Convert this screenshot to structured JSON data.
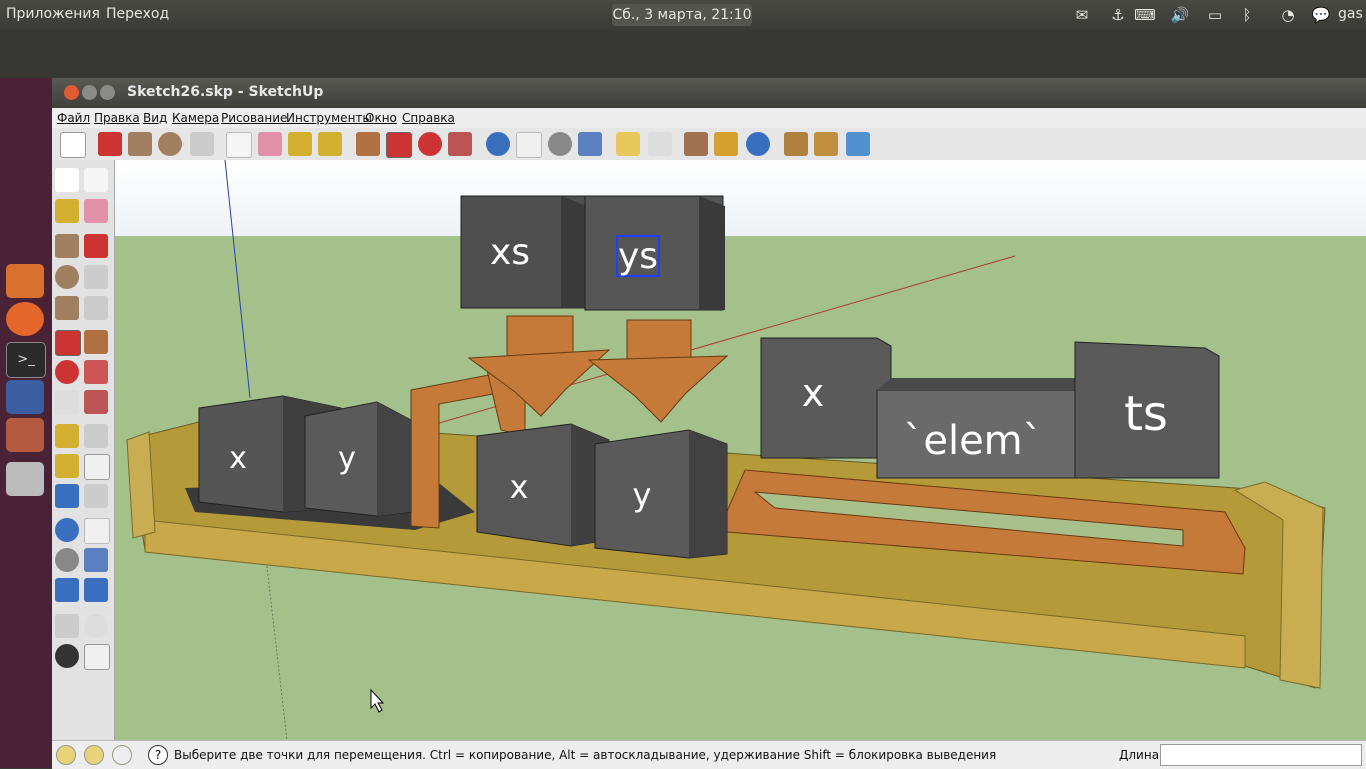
{
  "topbar": {
    "apps": "Приложения",
    "goto": "Переход",
    "clock": "Сб., 3 марта, 21:10",
    "user": "gas"
  },
  "window": {
    "title": "Sketch26.skp - SketchUp"
  },
  "menu": [
    "Файл",
    "Правка",
    "Вид",
    "Камера",
    "Рисование",
    "Инструменты",
    "Окно",
    "Справка"
  ],
  "scene": {
    "blocks": [
      "xs",
      "ys",
      "x",
      "y",
      "x",
      "y",
      "x",
      "`elem`",
      "ts"
    ]
  },
  "status": {
    "text": "Выберите две точки для перемещения.  Ctrl = копирование, Alt = автоскладывание, удерживание Shift = блокировка выведения",
    "length_label": "Длина",
    "length_value": ""
  },
  "colors": {
    "sky": "#ffffff",
    "ground": "#a4c18c",
    "wood": "#c57a3a",
    "block": "#4f4f4f",
    "launcher": "#4a2236"
  }
}
